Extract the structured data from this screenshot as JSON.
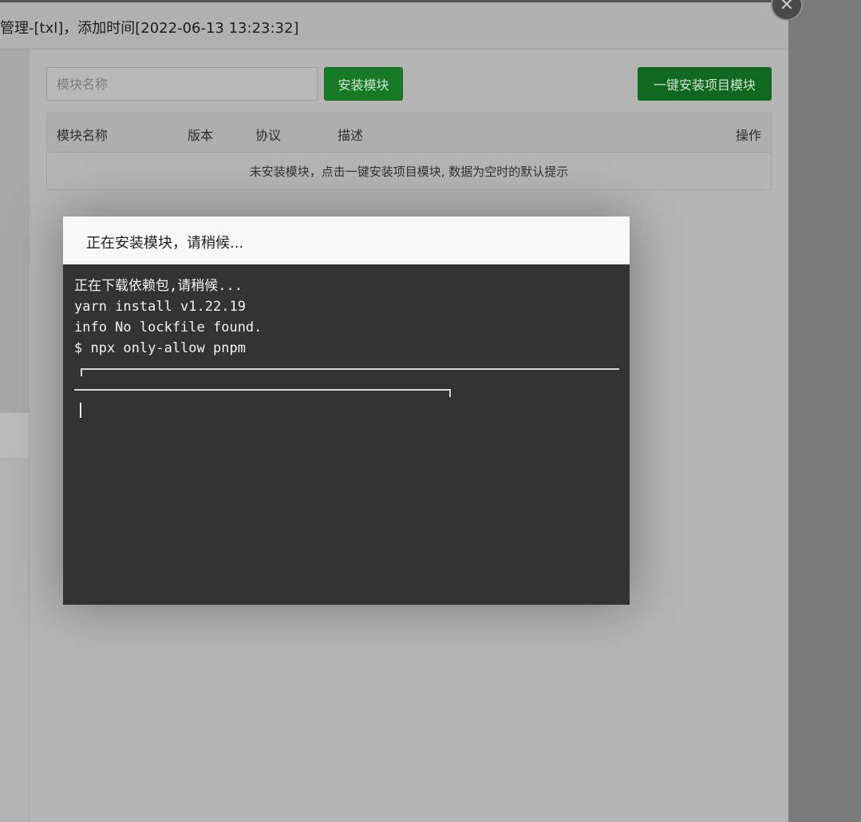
{
  "dialog": {
    "title": "管理-[txl]，添加时间[2022-06-13 13:23:32]",
    "close_icon": "close-icon"
  },
  "toolbar": {
    "search_placeholder": "模块名称",
    "install_label": "安装模块",
    "onekey_label": "一键安装项目模块"
  },
  "table": {
    "columns": [
      "模块名称",
      "版本",
      "协议",
      "描述",
      "操作"
    ],
    "empty_text": "未安装模块，点击一键安装项目模块, 数据为空时的默认提示"
  },
  "install_modal": {
    "title": "正在安装模块，请稍候...",
    "terminal_lines": [
      "正在下载依赖包,请稍候...",
      "yarn install v1.22.19",
      "info No lockfile found.",
      "$ npx only-allow pnpm"
    ]
  },
  "colors": {
    "accent_green": "#187a27",
    "terminal_bg": "#333333"
  }
}
